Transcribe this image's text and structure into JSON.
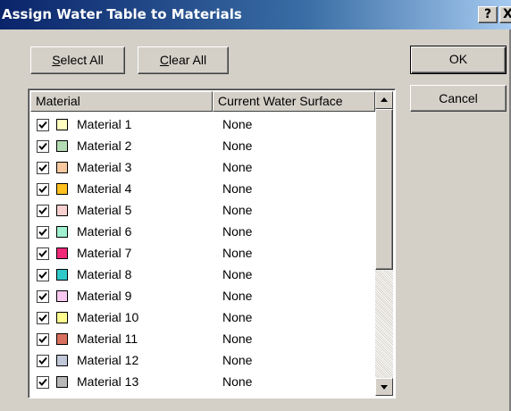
{
  "window": {
    "title": "Assign Water Table to Materials"
  },
  "titlebar": {
    "help_label": "?",
    "close_label": "X"
  },
  "buttons": {
    "select_all": {
      "mnemonic": "S",
      "rest": "elect All"
    },
    "clear_all": {
      "mnemonic": "C",
      "rest": "lear All"
    },
    "ok": "OK",
    "cancel": "Cancel"
  },
  "table": {
    "columns": [
      "Material",
      "Current Water Surface"
    ],
    "rows": [
      {
        "checked": true,
        "color": "#ffffc0",
        "name": "Material 1",
        "water": "None"
      },
      {
        "checked": true,
        "color": "#b4dcb4",
        "name": "Material 2",
        "water": "None"
      },
      {
        "checked": true,
        "color": "#f8c8a0",
        "name": "Material 3",
        "water": "None"
      },
      {
        "checked": true,
        "color": "#ffc020",
        "name": "Material 4",
        "water": "None"
      },
      {
        "checked": true,
        "color": "#f8d0d0",
        "name": "Material 5",
        "water": "None"
      },
      {
        "checked": true,
        "color": "#a0f0d0",
        "name": "Material 6",
        "water": "None"
      },
      {
        "checked": true,
        "color": "#f02878",
        "name": "Material 7",
        "water": "None"
      },
      {
        "checked": true,
        "color": "#30c8c8",
        "name": "Material 8",
        "water": "None"
      },
      {
        "checked": true,
        "color": "#f8c8f0",
        "name": "Material 9",
        "water": "None"
      },
      {
        "checked": true,
        "color": "#ffff90",
        "name": "Material 10",
        "water": "None"
      },
      {
        "checked": true,
        "color": "#d87060",
        "name": "Material 11",
        "water": "None"
      },
      {
        "checked": true,
        "color": "#c0c8d8",
        "name": "Material 12",
        "water": "None"
      },
      {
        "checked": true,
        "color": "#b8b8b8",
        "name": "Material 13",
        "water": "None"
      }
    ]
  }
}
